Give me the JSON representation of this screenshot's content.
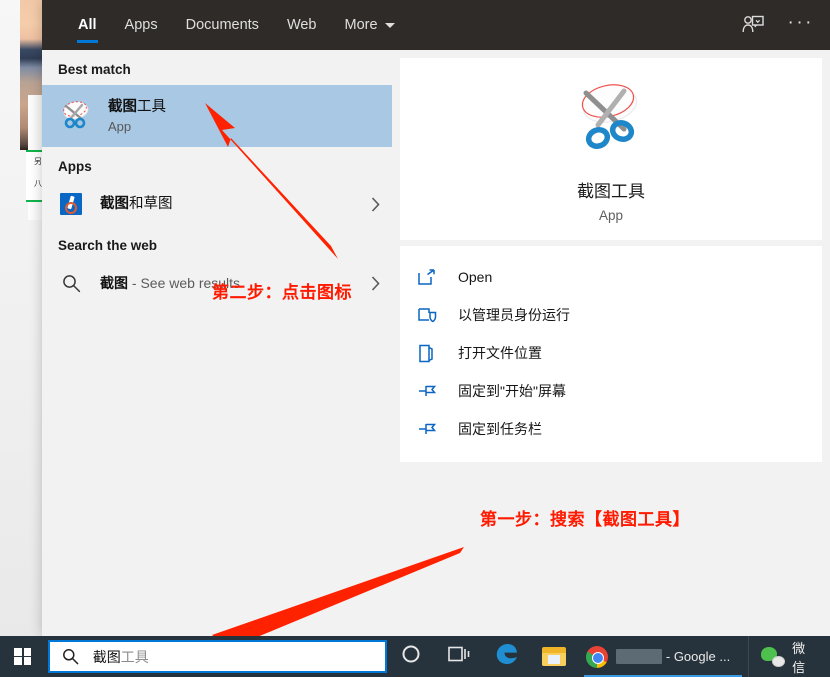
{
  "header": {
    "tabs": [
      {
        "label": "All",
        "active": true
      },
      {
        "label": "Apps",
        "active": false
      },
      {
        "label": "Documents",
        "active": false
      },
      {
        "label": "Web",
        "active": false
      },
      {
        "label": "More",
        "active": false,
        "has_caret": true
      }
    ],
    "account_icon": "account-person-icon",
    "more_icon": "ellipsis-icon",
    "background_color": "#2f2b28",
    "accent_color": "#0078d7"
  },
  "left_panel": {
    "best_match_heading": "Best match",
    "best_match": {
      "title_bold": "截图",
      "title_plain": "工具",
      "subtitle": "App",
      "icon": "snipping-tool-icon",
      "selected": true,
      "highlight_color": "#a8c8e4"
    },
    "apps_heading": "Apps",
    "apps": [
      {
        "title_bold": "截图",
        "title_plain": "和草图",
        "icon": "snip-and-sketch-icon",
        "chevron": "chevron-right-icon"
      }
    ],
    "web_heading": "Search the web",
    "web_results": [
      {
        "query": "截图",
        "suffix": " - See web results",
        "icon": "search-icon",
        "chevron": "chevron-right-icon"
      }
    ]
  },
  "right_panel": {
    "app_name": "截图工具",
    "app_type": "App",
    "app_icon": "snipping-tool-icon",
    "actions": [
      {
        "label": "Open",
        "icon": "open-window-icon"
      },
      {
        "label": "以管理员身份运行",
        "icon": "shield-admin-icon"
      },
      {
        "label": "打开文件位置",
        "icon": "folder-open-icon"
      },
      {
        "label": "固定到\"开始\"屏幕",
        "icon": "pin-icon"
      },
      {
        "label": "固定到任务栏",
        "icon": "pin-icon"
      }
    ]
  },
  "annotations": [
    {
      "text": "第二步：点击图标",
      "color": "#ff1a00"
    },
    {
      "text": "第一步：搜索【截图工具】",
      "color": "#ff1a00"
    }
  ],
  "taskbar": {
    "background_color": "#27333c",
    "start_button": "windows-start-icon",
    "search": {
      "icon": "search-icon",
      "typed_text": "截图",
      "suggestion_text": "工具",
      "border_color": "#0078d7"
    },
    "items": [
      {
        "name": "cortana",
        "icon": "cortana-circle-icon",
        "label": ""
      },
      {
        "name": "task-view",
        "icon": "task-view-icon",
        "label": ""
      },
      {
        "name": "edge",
        "icon": "edge-icon",
        "label": ""
      },
      {
        "name": "file-explorer",
        "icon": "file-explorer-icon",
        "label": ""
      },
      {
        "name": "chrome",
        "icon": "chrome-icon",
        "label": " - Google ...",
        "active": true
      },
      {
        "name": "wechat",
        "icon": "wechat-icon",
        "label": "微信"
      }
    ]
  },
  "desktop": {
    "green_box_text_1": "另",
    "green_box_text_2": "八"
  }
}
